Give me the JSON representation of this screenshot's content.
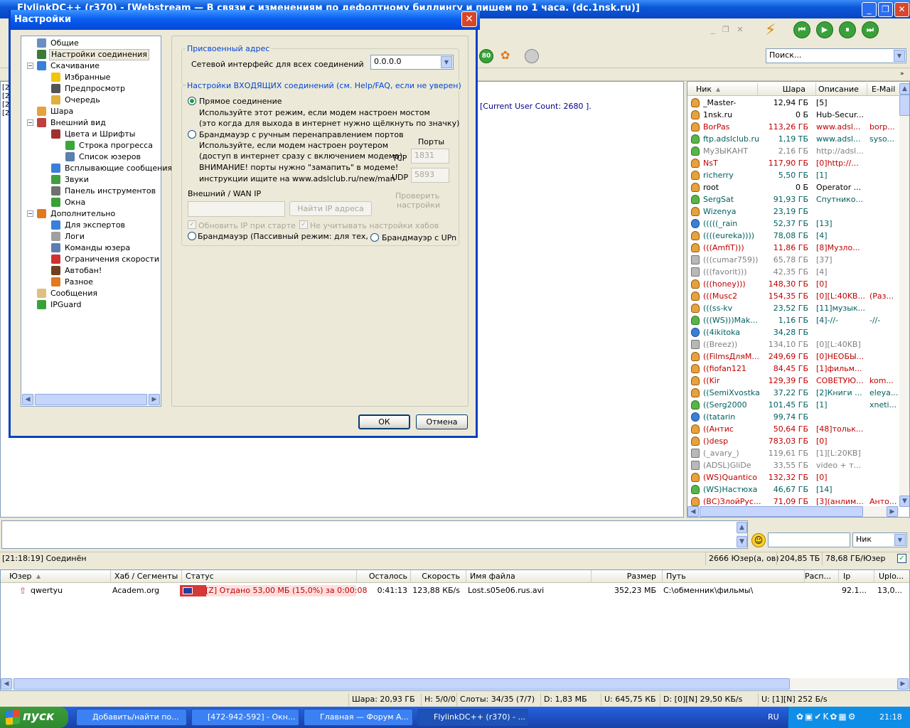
{
  "main_window": {
    "title": "FlylinkDC++ (r370) - [Webstream — В связи с изменениям по дефолтному биллингу и пишем по 1 часа. (dc.1nsk.ru)]"
  },
  "toolbar": {
    "search_placeholder": "Поиск..."
  },
  "chat": {
    "user_count_line": "[Current User Count: 2680 ]."
  },
  "userlist": {
    "columns": [
      "Ник",
      "Шара",
      "Описание",
      "E-Mail"
    ],
    "rows": [
      {
        "nick": "_Master-",
        "share": "12,94 ГБ",
        "desc": "[5]",
        "email": "",
        "color": "#000000",
        "icon": "user"
      },
      {
        "nick": "1nsk.ru",
        "share": "0 Б",
        "desc": "Hub-Secur...",
        "email": "",
        "color": "#000000",
        "icon": "user"
      },
      {
        "nick": "BorPas",
        "share": "113,26 ГБ",
        "desc": "www.adsl...",
        "email": "borp...",
        "color": "#c00000",
        "icon": "user"
      },
      {
        "nick": "ftp.adslclub.ru",
        "share": "1,19 ТБ",
        "desc": "www.adsl...",
        "email": "syso...",
        "color": "#006060",
        "icon": "green"
      },
      {
        "nick": "МуЗЫКАНТ",
        "share": "2,16 ГБ",
        "desc": "http://adsl...",
        "email": "",
        "color": "#808080",
        "icon": "green"
      },
      {
        "nick": "NsT",
        "share": "117,90 ГБ",
        "desc": "[0]http://...",
        "email": "",
        "color": "#c00000",
        "icon": "user"
      },
      {
        "nick": "richerry",
        "share": "5,50 ГБ",
        "desc": "[1]",
        "email": "",
        "color": "#006060",
        "icon": "user"
      },
      {
        "nick": "root",
        "share": "0 Б",
        "desc": "Operator ...",
        "email": "",
        "color": "#000000",
        "icon": "user"
      },
      {
        "nick": "SergSat",
        "share": "91,93 ГБ",
        "desc": "Спутнико...",
        "email": "",
        "color": "#006060",
        "icon": "green"
      },
      {
        "nick": "Wizenya",
        "share": "23,19 ГБ",
        "desc": "",
        "email": "",
        "color": "#006060",
        "icon": "user"
      },
      {
        "nick": "(((((_rain",
        "share": "52,37 ГБ",
        "desc": "[13]",
        "email": "",
        "color": "#006060",
        "icon": "blue"
      },
      {
        "nick": "((((eureka))))",
        "share": "78,08 ГБ",
        "desc": "[4]",
        "email": "",
        "color": "#006060",
        "icon": "user"
      },
      {
        "nick": "(((AmfiT)))",
        "share": "11,86 ГБ",
        "desc": "[8]Музло...",
        "email": "",
        "color": "#c00000",
        "icon": "user"
      },
      {
        "nick": "(((cumar759))",
        "share": "65,78 ГБ",
        "desc": "[37]",
        "email": "",
        "color": "#808080",
        "icon": "grey"
      },
      {
        "nick": "(((favorit)))",
        "share": "42,35 ГБ",
        "desc": "[4]",
        "email": "",
        "color": "#808080",
        "icon": "grey"
      },
      {
        "nick": "(((honey)))",
        "share": "148,30 ГБ",
        "desc": "[0]",
        "email": "",
        "color": "#c00000",
        "icon": "user"
      },
      {
        "nick": "(((Musc2",
        "share": "154,35 ГБ",
        "desc": "[0][L:40KB...",
        "email": "(Раз...",
        "color": "#c00000",
        "icon": "user"
      },
      {
        "nick": "(((ss-kv",
        "share": "23,52 ГБ",
        "desc": "[11]музык...",
        "email": "",
        "color": "#006060",
        "icon": "user"
      },
      {
        "nick": "(((WS)))Mak...",
        "share": "1,16 ГБ",
        "desc": "[4]-//-",
        "email": "-//-",
        "color": "#006060",
        "icon": "green"
      },
      {
        "nick": "((4ikitoka",
        "share": "34,28 ГБ",
        "desc": "",
        "email": "",
        "color": "#006060",
        "icon": "blue"
      },
      {
        "nick": "((Breez))",
        "share": "134,10 ГБ",
        "desc": "[0][L:40KB]",
        "email": "",
        "color": "#808080",
        "icon": "grey"
      },
      {
        "nick": "((FilmsДляМ...",
        "share": "249,69 ГБ",
        "desc": "[0]НЕОБЫ...",
        "email": "",
        "color": "#c00000",
        "icon": "user"
      },
      {
        "nick": "((fiofan121",
        "share": "84,45 ГБ",
        "desc": "[1]фильм...",
        "email": "",
        "color": "#c00000",
        "icon": "user"
      },
      {
        "nick": "((Kir",
        "share": "129,39 ГБ",
        "desc": "СОВЕТУЮ...",
        "email": "kom...",
        "color": "#c00000",
        "icon": "user"
      },
      {
        "nick": "((SemiXvostka",
        "share": "37,22 ГБ",
        "desc": "[2]Книги ...",
        "email": "eleya...",
        "color": "#006060",
        "icon": "user"
      },
      {
        "nick": "((Serg2000",
        "share": "101,45 ГБ",
        "desc": "[1]",
        "email": "xneti...",
        "color": "#006060",
        "icon": "green"
      },
      {
        "nick": "((tatarin",
        "share": "99,74 ГБ",
        "desc": "",
        "email": "",
        "color": "#006060",
        "icon": "blue"
      },
      {
        "nick": "((Антис",
        "share": "50,64 ГБ",
        "desc": "[48]тольк...",
        "email": "",
        "color": "#c00000",
        "icon": "user"
      },
      {
        "nick": "()desp",
        "share": "783,03 ГБ",
        "desc": "[0]",
        "email": "",
        "color": "#c00000",
        "icon": "user"
      },
      {
        "nick": "(_avary_)",
        "share": "119,61 ГБ",
        "desc": "[1][L:20KB]",
        "email": "",
        "color": "#808080",
        "icon": "grey"
      },
      {
        "nick": "(ADSL)GliDe",
        "share": "33,55 ГБ",
        "desc": "video + т...",
        "email": "",
        "color": "#808080",
        "icon": "grey"
      },
      {
        "nick": "(WS)Quantico",
        "share": "132,32 ГБ",
        "desc": "[0]",
        "email": "",
        "color": "#c00000",
        "icon": "user"
      },
      {
        "nick": "(WS)Настюха",
        "share": "46,67 ГБ",
        "desc": "[14]",
        "email": "",
        "color": "#006060",
        "icon": "green"
      },
      {
        "nick": "(ВС)ЗлойРус...",
        "share": "71,09 ГБ",
        "desc": "[3](анлим...",
        "email": "Анто...",
        "color": "#c00000",
        "icon": "user"
      }
    ]
  },
  "chatbar": {
    "filter_select": "Ник"
  },
  "statusbar1": {
    "message": "[21:18:19] Соединён",
    "users": "2666 Юзер(а, ов)",
    "total_share": "204,85 ТБ",
    "per_user": "78,68 ГБ/Юзер"
  },
  "transfers": {
    "columns": [
      "Юзер",
      "Хаб / Сегменты",
      "Статус",
      "Осталось",
      "Скорость",
      "Имя файла",
      "Размер",
      "Путь",
      "Расп...",
      "Ip",
      "Uplo..."
    ],
    "row": {
      "user": "qwertyu",
      "hub": "Academ.org",
      "status": "[Z] Отдано 53,00 МБ (15,0%) за 0:00:08",
      "progress": 0.15,
      "left": "0:41:13",
      "speed": "123,88 КБ/s",
      "file": "Lost.s05e06.rus.avi",
      "size": "352,23 МБ",
      "path": "C:\\обменник\\фильмы\\",
      "ip": "92.1...",
      "upload": "13,0..."
    }
  },
  "statusbar2": {
    "share": "Шара: 20,93 ГБ",
    "hubs": "H: 5/0/0",
    "slots": "Слоты: 34/35 (7/7)",
    "down": "D: 1,83 МБ",
    "up": "U: 645,75 КБ",
    "dspeed": "D: [0][N] 29,50 КБ/s",
    "uspeed": "U: [1][N] 252 Б/s"
  },
  "dialog": {
    "title": "Настройки",
    "tree": [
      {
        "label": "Общие",
        "level": 1,
        "color": "#6b8fbf"
      },
      {
        "label": "Настройки соединения",
        "level": 1,
        "color": "#3b7a3b",
        "selected": true
      },
      {
        "label": "Скачивание",
        "level": 1,
        "color": "#3a7fd8"
      },
      {
        "label": "Избранные",
        "level": 2,
        "color": "#f2c40c"
      },
      {
        "label": "Предпросмотр",
        "level": 2,
        "color": "#555555"
      },
      {
        "label": "Очередь",
        "level": 2,
        "color": "#e0b040"
      },
      {
        "label": "Шара",
        "level": 1,
        "color": "#e6a23c"
      },
      {
        "label": "Внешний вид",
        "level": 1,
        "color": "#c04040"
      },
      {
        "label": "Цвета и Шрифты",
        "level": 2,
        "color": "#a03030"
      },
      {
        "label": "Строка прогресса",
        "level": 3,
        "color": "#38a838"
      },
      {
        "label": "Список юзеров",
        "level": 3,
        "color": "#5a7fb0"
      },
      {
        "label": "Всплывающие сообщения",
        "level": 2,
        "color": "#3a7fd8"
      },
      {
        "label": "Звуки",
        "level": 2,
        "color": "#40a040"
      },
      {
        "label": "Панель инструментов",
        "level": 2,
        "color": "#707070"
      },
      {
        "label": "Окна",
        "level": 2,
        "color": "#3aa13a"
      },
      {
        "label": "Дополнительно",
        "level": 1,
        "color": "#e07a20"
      },
      {
        "label": "Для экспертов",
        "level": 2,
        "color": "#3a7fd8"
      },
      {
        "label": "Логи",
        "level": 2,
        "color": "#a0a0a0"
      },
      {
        "label": "Команды юзера",
        "level": 2,
        "color": "#5a7fb0"
      },
      {
        "label": "Ограничения скорости",
        "level": 2,
        "color": "#d03030"
      },
      {
        "label": "Автобан!",
        "level": 2,
        "color": "#704020"
      },
      {
        "label": "Разное",
        "level": 2,
        "color": "#e07a20"
      },
      {
        "label": "Сообщения",
        "level": 1,
        "color": "#e0c080"
      },
      {
        "label": "IPGuard",
        "level": 1,
        "color": "#3aa13a"
      }
    ],
    "assigned_legend": "Присвоенный адрес",
    "iface_label": "Сетевой интерфейс для всех соединений",
    "iface_value": "0.0.0.0",
    "incoming_legend": "Настройки ВХОДЯЩИХ соединений (см. Help/FAQ, если не уверен)",
    "direct_label": "Прямое соединение",
    "direct_hint1": "Используйте этот режим, если модем настроен мостом",
    "direct_hint2": "(это когда для выхода в интернет нужно щёлкнуть по значку)",
    "manual_label": "Брандмауэр с ручным перенаправлением портов",
    "manual_hint1": "Используйте, если модем настроен роутером",
    "manual_hint2": "(доступ в интернет сразу с включением модема)",
    "manual_hint3": "ВНИМАНИЕ! порты нужно \"замапить\" в модеме!",
    "manual_hint4": "инструкции ищите на www.adslclub.ru/new/man",
    "ports_label": "Порты",
    "tcp_label": "TCP",
    "tcp_value": "1831",
    "udp_label": "UDP",
    "udp_value": "5893",
    "wan_label": "Внешний / WAN IP",
    "find_ip_button": "Найти IP адреса",
    "check_settings_l1": "Проверить",
    "check_settings_l2": "настройки",
    "update_ip_label": "Обновить IP при старте",
    "ignore_hubs_label": "Не учитывать настройки хабов",
    "passive_label": "Брандмауэр (Пассивный режим: для тех,",
    "upnp_label": "Брандмауэр с UPnP (",
    "ok_button": "ОК",
    "cancel_button": "Отмена"
  },
  "taskbar": {
    "start": "пуск",
    "tasks": [
      "Добавить/найти по...",
      "[472-942-592] - Окн...",
      "Главная — Форум A...",
      "FlylinkDC++ (r370) - ..."
    ],
    "lang": "RU",
    "clock": "21:18"
  }
}
